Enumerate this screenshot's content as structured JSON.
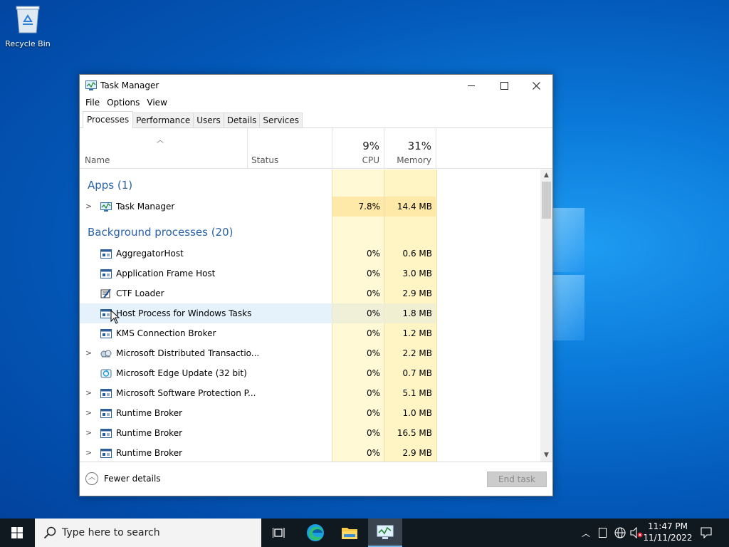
{
  "desktop": {
    "recycle_bin_label": "Recycle Bin"
  },
  "window": {
    "title": "Task Manager",
    "controls": {
      "minimize": "—",
      "maximize": "☐",
      "close": "✕"
    },
    "menu": [
      "File",
      "Options",
      "View"
    ],
    "tabs": [
      "Processes",
      "Performance",
      "Users",
      "Details",
      "Services"
    ],
    "active_tab": "Processes",
    "columns": {
      "name": "Name",
      "status": "Status",
      "cpu_pct": "9%",
      "cpu_label": "CPU",
      "memory_pct": "31%",
      "memory_label": "Memory"
    },
    "groups": {
      "apps": "Apps (1)",
      "background": "Background processes (20)"
    },
    "apps": [
      {
        "name": "Task Manager",
        "cpu": "7.8%",
        "memory": "14.4 MB",
        "expandable": true,
        "icon": "task-manager-icon"
      }
    ],
    "background": [
      {
        "name": "AggregatorHost",
        "cpu": "0%",
        "memory": "0.6 MB",
        "expandable": false,
        "icon": "window-process-icon"
      },
      {
        "name": "Application Frame Host",
        "cpu": "0%",
        "memory": "3.0 MB",
        "expandable": false,
        "icon": "window-process-icon"
      },
      {
        "name": "CTF Loader",
        "cpu": "0%",
        "memory": "2.9 MB",
        "expandable": false,
        "icon": "ctf-loader-icon"
      },
      {
        "name": "Host Process for Windows Tasks",
        "cpu": "0%",
        "memory": "1.8 MB",
        "expandable": false,
        "icon": "window-process-icon"
      },
      {
        "name": "KMS Connection Broker",
        "cpu": "0%",
        "memory": "1.2 MB",
        "expandable": false,
        "icon": "window-process-icon"
      },
      {
        "name": "Microsoft Distributed Transactio...",
        "cpu": "0%",
        "memory": "2.2 MB",
        "expandable": true,
        "icon": "dtc-icon"
      },
      {
        "name": "Microsoft Edge Update (32 bit)",
        "cpu": "0%",
        "memory": "0.7 MB",
        "expandable": false,
        "icon": "edge-update-icon"
      },
      {
        "name": "Microsoft Software Protection P...",
        "cpu": "0%",
        "memory": "5.1 MB",
        "expandable": true,
        "icon": "window-process-icon"
      },
      {
        "name": "Runtime Broker",
        "cpu": "0%",
        "memory": "1.0 MB",
        "expandable": true,
        "icon": "window-process-icon"
      },
      {
        "name": "Runtime Broker",
        "cpu": "0%",
        "memory": "16.5 MB",
        "expandable": true,
        "icon": "window-process-icon"
      },
      {
        "name": "Runtime Broker",
        "cpu": "0%",
        "memory": "2.9 MB",
        "expandable": true,
        "icon": "window-process-icon"
      }
    ],
    "footer": {
      "fewer_details": "Fewer details",
      "end_task": "End task"
    }
  },
  "taskbar": {
    "search_placeholder": "Type here to search",
    "time": "11:47 PM",
    "date": "11/11/2022"
  },
  "colors": {
    "group_header": "#2a62a8",
    "cpu_band": "#fff9d6",
    "memory_band": "#fff4c4",
    "highlight_row": "#e5f1fb",
    "taskbar": "#101820"
  }
}
